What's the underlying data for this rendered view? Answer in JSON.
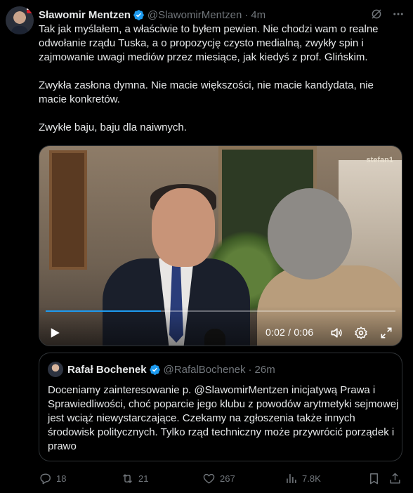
{
  "tweet": {
    "author_name": "Sławomir Mentzen",
    "author_handle": "@SlawomirMentzen",
    "separator": "·",
    "time": "4m",
    "paragraphs": [
      "Tak jak myślałem, a właściwie to byłem pewien. Nie chodzi wam o realne odwołanie rządu Tuska, a o propozycję czysto medialną, zwykły spin i zajmowanie uwagi mediów przez miesiące, jak kiedyś z prof. Glińskim.",
      "Zwykła zasłona dymna. Nie macie większości, nie macie kandydata, nie macie konkretów.",
      "Zwykłe baju, baju dla naiwnych."
    ]
  },
  "video": {
    "timecode": "0:02 / 0:06",
    "progress": 0.33,
    "watermark": "stefan1",
    "accent": "#1d9bf0"
  },
  "quote": {
    "author_name": "Rafał Bochenek",
    "author_handle": "@RafalBochenek",
    "separator": "·",
    "time": "26m",
    "text": "Doceniamy zainteresowanie p. @SlawomirMentzen inicjatywą Prawa i Sprawiedliwości, choć poparcie jego klubu z powodów arytmetyki sejmowej jest wciąż niewystarczające. Czekamy na zgłoszenia także innych środowisk politycznych. Tylko rząd techniczny może przywrócić porządek i prawo"
  },
  "actions": {
    "replies": "18",
    "reposts": "21",
    "likes": "267",
    "views": "7.8K"
  },
  "colors": {
    "background": "#000000",
    "text": "#e7e9ea",
    "muted": "#71767b",
    "verified": "#1d9bf0",
    "border": "#2f3336"
  },
  "icons": [
    "verified-badge-icon",
    "grok-icon",
    "more-icon",
    "play-icon",
    "volume-icon",
    "settings-icon",
    "fullscreen-icon",
    "reply-icon",
    "repost-icon",
    "like-icon",
    "views-icon",
    "bookmark-icon",
    "share-icon"
  ]
}
